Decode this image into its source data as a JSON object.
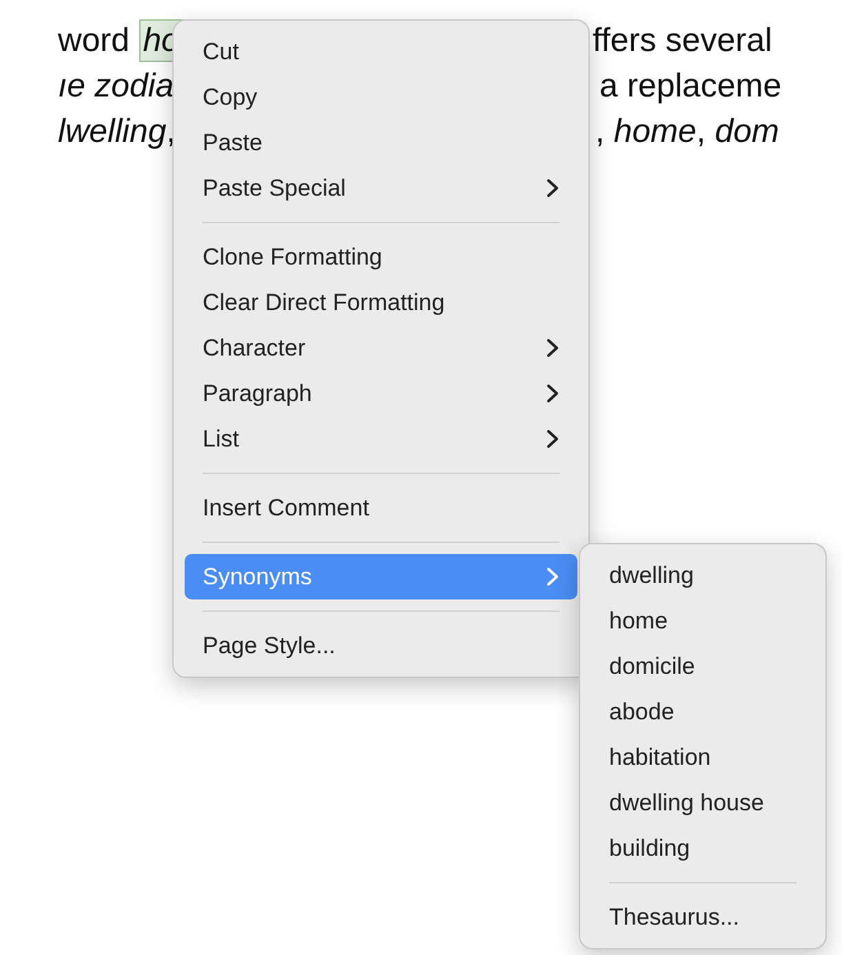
{
  "document": {
    "lines": [
      {
        "left": [
          {
            "text": "word ",
            "highlighted": false
          },
          {
            "text": "*ho*",
            "highlighted": true
          }
        ],
        "right": [
          {
            "text": "ffers several",
            "highlighted": false
          }
        ]
      },
      {
        "left": [
          {
            "text": "*ıe zodia*",
            "highlighted": false
          }
        ],
        "right": [
          {
            "text": "a replaceme",
            "highlighted": false
          }
        ]
      },
      {
        "left": [
          {
            "text": "*lwelling*,",
            "highlighted": false
          }
        ],
        "right": [
          {
            "text": ", *home*, *dom*",
            "highlighted": false
          }
        ]
      }
    ]
  },
  "menu": {
    "items": [
      {
        "kind": "item",
        "label": "Cut",
        "submenu": false,
        "selected": false
      },
      {
        "kind": "item",
        "label": "Copy",
        "submenu": false,
        "selected": false
      },
      {
        "kind": "item",
        "label": "Paste",
        "submenu": false,
        "selected": false
      },
      {
        "kind": "item",
        "label": "Paste Special",
        "submenu": true,
        "selected": false
      },
      {
        "kind": "separator"
      },
      {
        "kind": "item",
        "label": "Clone Formatting",
        "submenu": false,
        "selected": false
      },
      {
        "kind": "item",
        "label": "Clear Direct Formatting",
        "submenu": false,
        "selected": false
      },
      {
        "kind": "item",
        "label": "Character",
        "submenu": true,
        "selected": false
      },
      {
        "kind": "item",
        "label": "Paragraph",
        "submenu": true,
        "selected": false
      },
      {
        "kind": "item",
        "label": "List",
        "submenu": true,
        "selected": false
      },
      {
        "kind": "separator"
      },
      {
        "kind": "item",
        "label": "Insert Comment",
        "submenu": false,
        "selected": false
      },
      {
        "kind": "separator"
      },
      {
        "kind": "item",
        "label": "Synonyms",
        "submenu": true,
        "selected": true
      },
      {
        "kind": "separator"
      },
      {
        "kind": "item",
        "label": "Page Style...",
        "submenu": false,
        "selected": false
      }
    ]
  },
  "submenu": {
    "items": [
      {
        "kind": "item",
        "label": "dwelling",
        "submenu": false,
        "selected": false
      },
      {
        "kind": "item",
        "label": "home",
        "submenu": false,
        "selected": false
      },
      {
        "kind": "item",
        "label": "domicile",
        "submenu": false,
        "selected": false
      },
      {
        "kind": "item",
        "label": "abode",
        "submenu": false,
        "selected": false
      },
      {
        "kind": "item",
        "label": "habitation",
        "submenu": false,
        "selected": false
      },
      {
        "kind": "item",
        "label": "dwelling house",
        "submenu": false,
        "selected": false
      },
      {
        "kind": "item",
        "label": "building",
        "submenu": false,
        "selected": false
      },
      {
        "kind": "separator"
      },
      {
        "kind": "item",
        "label": "Thesaurus...",
        "submenu": false,
        "selected": false
      }
    ]
  }
}
